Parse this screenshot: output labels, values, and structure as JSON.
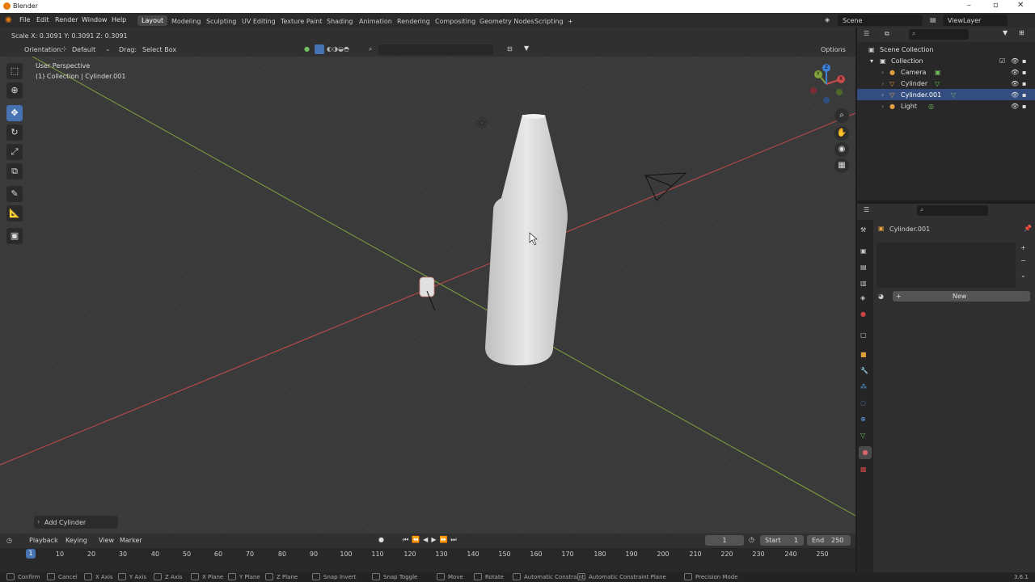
{
  "window": {
    "title": "Blender"
  },
  "menu": [
    "File",
    "Edit",
    "Render",
    "Window",
    "Help"
  ],
  "workspaces": [
    "Layout",
    "Modeling",
    "Sculpting",
    "UV Editing",
    "Texture Paint",
    "Shading",
    "Animation",
    "Rendering",
    "Compositing",
    "Geometry Nodes",
    "Scripting",
    "+"
  ],
  "scene": {
    "name": "Scene",
    "view_layer": "ViewLayer"
  },
  "op_header": {
    "scale_text": "Scale X: 0.3091   Y: 0.3091   Z: 0.3091"
  },
  "tool_header": {
    "orientation_label": "Orientation:",
    "orientation_value": "Default",
    "drag_label": "Drag:",
    "drag_value": "Select Box",
    "options": "Options"
  },
  "viewport": {
    "view_name": "User Perspective",
    "collection_info": "(1) Collection | Cylinder.001",
    "last_op": "Add Cylinder",
    "gizmo": {
      "x": "X",
      "y": "Y",
      "z": "Z"
    }
  },
  "outliner": {
    "root": "Scene Collection",
    "collection": "Collection",
    "items": [
      "Camera",
      "Cylinder",
      "Cylinder.001",
      "Light"
    ],
    "selected": "Cylinder.001"
  },
  "properties": {
    "object": "Cylinder.001",
    "new_button": "New"
  },
  "timeline": {
    "menus": [
      "Playback",
      "Keying",
      "View",
      "Marker"
    ],
    "current_frame": "1",
    "start_label": "Start",
    "start": "1",
    "end_label": "End",
    "end": "250",
    "ticks": [
      "1",
      "10",
      "20",
      "30",
      "40",
      "50",
      "60",
      "70",
      "80",
      "90",
      "100",
      "110",
      "120",
      "130",
      "140",
      "150",
      "160",
      "170",
      "180",
      "190",
      "200",
      "210",
      "220",
      "230",
      "240",
      "250"
    ]
  },
  "statusbar": {
    "items": [
      "Confirm",
      "Cancel",
      "X Axis",
      "Y Axis",
      "Z Axis",
      "X Plane",
      "Y Plane",
      "Z Plane",
      "Snap Invert",
      "Snap Toggle",
      "Move",
      "Rotate",
      "Automatic Constraint",
      "Automatic Constraint Plane",
      "Precision Mode"
    ],
    "version": "3.6.1"
  },
  "colors": {
    "accent": "#4772b3",
    "x_axis": "#c94b4b",
    "y_axis": "#7fa33a",
    "z_axis": "#3f7fd6",
    "selected_row": "#334d80"
  }
}
